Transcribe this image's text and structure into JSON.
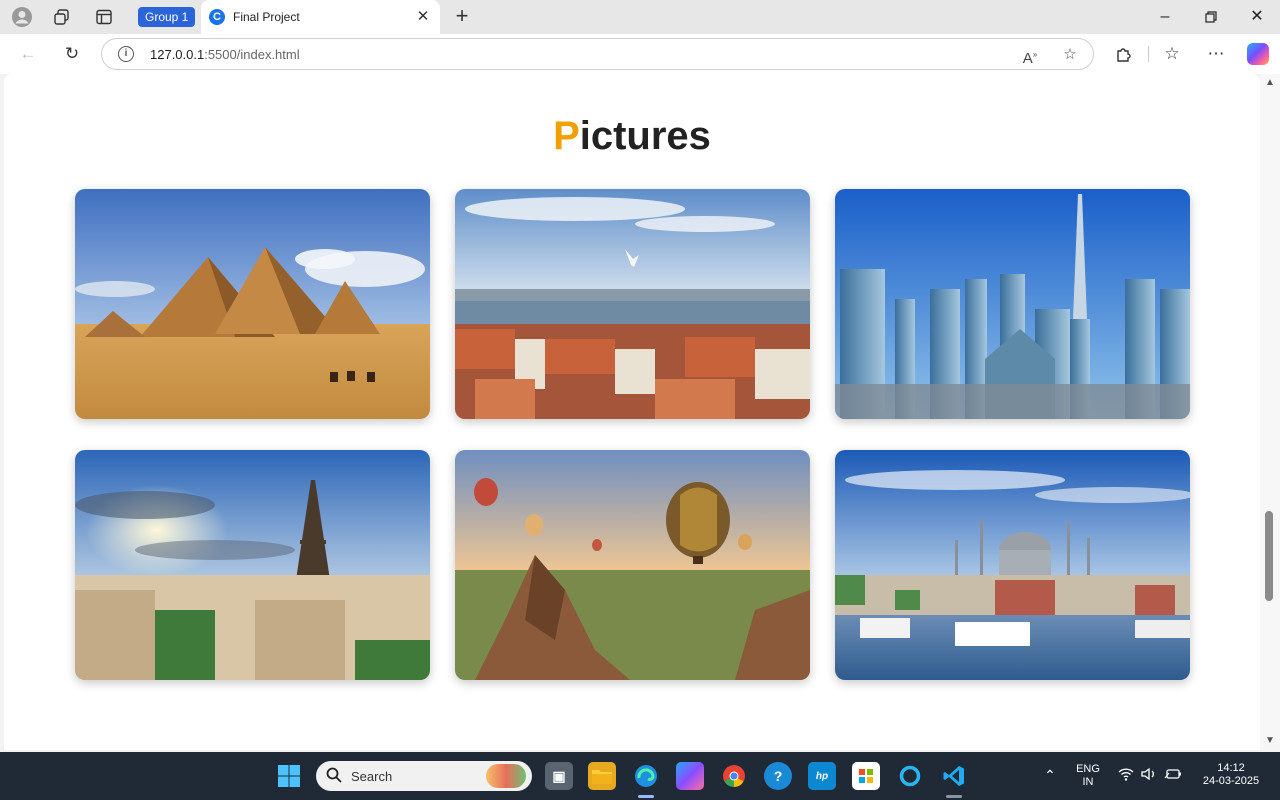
{
  "browser": {
    "tab_group_label": "Group 1",
    "tab_title": "Final Project",
    "favicon_letter": "C",
    "url_host": "127.0.0.1",
    "url_rest": ":5500/index.html"
  },
  "page": {
    "title_first_letter": "P",
    "title_rest": "ictures",
    "accent_color": "#f0a000",
    "gallery": [
      {
        "subject": "pyramids"
      },
      {
        "subject": "city-skyline-harbor"
      },
      {
        "subject": "skyscrapers"
      },
      {
        "subject": "eiffel-tower"
      },
      {
        "subject": "hot-air-balloons"
      },
      {
        "subject": "mosque-waterfront"
      }
    ]
  },
  "taskbar": {
    "search_label": "Search",
    "lang_line1": "ENG",
    "lang_line2": "IN",
    "time": "14:12",
    "date": "24-03-2025"
  }
}
